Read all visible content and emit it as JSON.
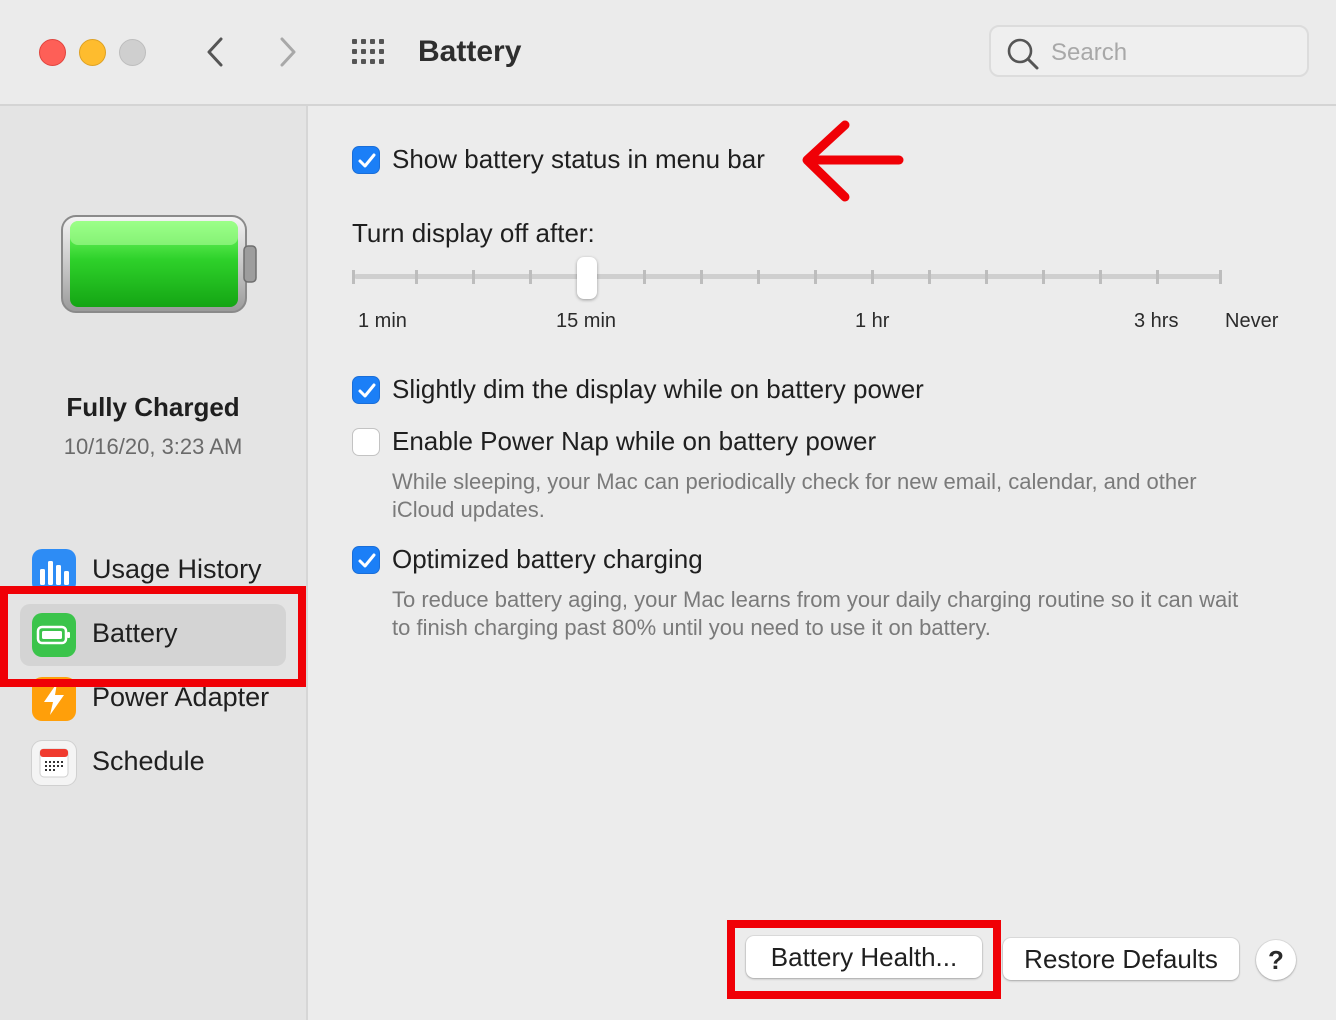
{
  "window": {
    "title": "Battery",
    "search_placeholder": "Search"
  },
  "sidebar": {
    "status_title": "Fully Charged",
    "status_date": "10/16/20, 3:23 AM",
    "items": [
      {
        "label": "Usage History",
        "icon": "bar-chart-icon"
      },
      {
        "label": "Battery",
        "icon": "battery-icon",
        "selected": true
      },
      {
        "label": "Power Adapter",
        "icon": "lightning-icon"
      },
      {
        "label": "Schedule",
        "icon": "calendar-icon"
      }
    ]
  },
  "main": {
    "show_status": {
      "label": "Show battery status in menu bar",
      "checked": true
    },
    "display_off": {
      "label": "Turn display off after:",
      "tick_labels": [
        "1 min",
        "15 min",
        "1 hr",
        "3 hrs",
        "Never"
      ],
      "value": "15 min"
    },
    "dim_display": {
      "label": "Slightly dim the display while on battery power",
      "checked": true
    },
    "power_nap": {
      "label": "Enable Power Nap while on battery power",
      "checked": false,
      "description_line1": "While sleeping, your Mac can periodically check for new email, calendar, and other",
      "description_line2": "iCloud updates."
    },
    "optimized_charging": {
      "label": "Optimized battery charging",
      "checked": true,
      "description_line1": "To reduce battery aging, your Mac learns from your daily charging routine so it can wait",
      "description_line2": "to finish charging past 80% until you need to use it on battery."
    }
  },
  "buttons": {
    "battery_health": "Battery Health...",
    "restore_defaults": "Restore Defaults",
    "help": "?"
  },
  "colors": {
    "accent": "#1b7ff7",
    "annotation_red": "#f00006",
    "battery_green": "#2ed12a"
  }
}
